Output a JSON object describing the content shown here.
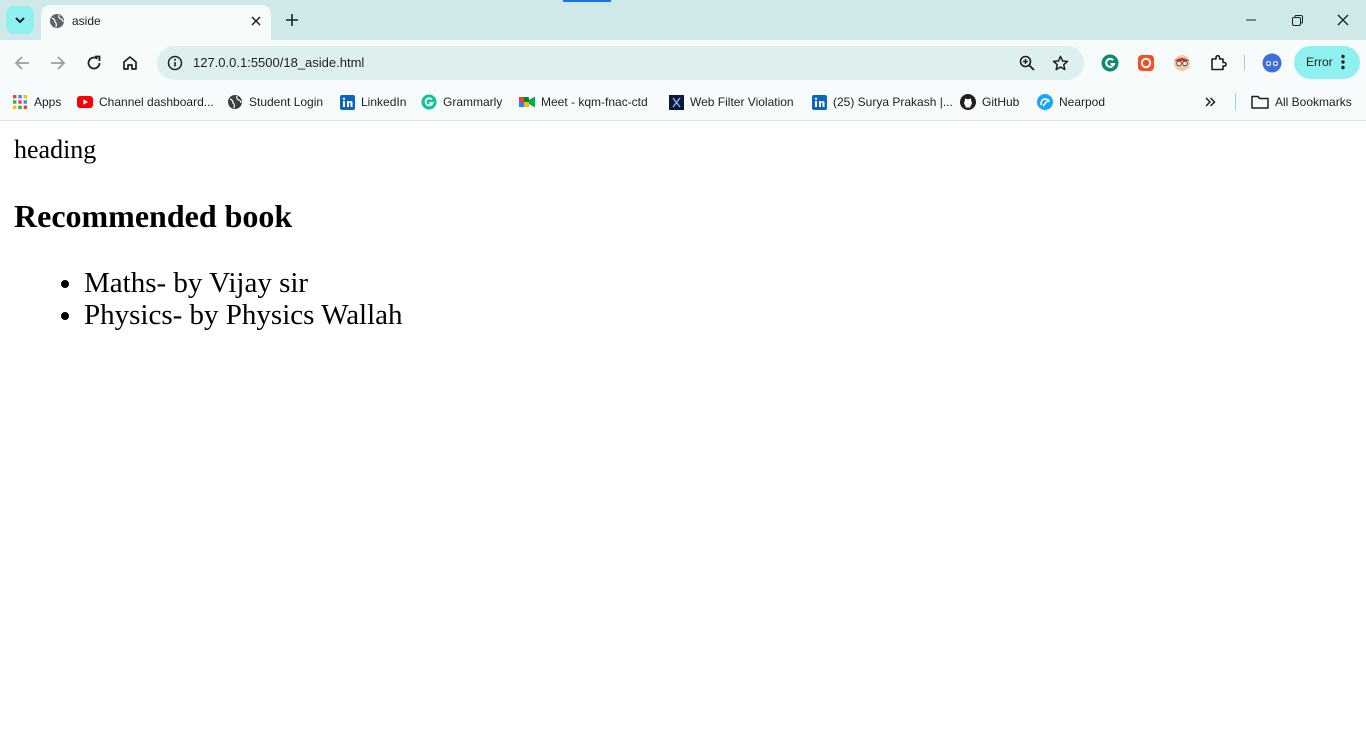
{
  "browser": {
    "tab": {
      "title": "aside",
      "favicon": "globe-icon"
    },
    "omnibox": {
      "url": "127.0.0.1:5500/18_aside.html"
    },
    "profile_button": {
      "label": "Error"
    },
    "colors": {
      "accent": "#1a73e8",
      "tabstrip": "#cfe8e8",
      "toolbar": "#f8fbfb",
      "omnibox": "#ddefef",
      "error_pill": "#8ff0f0"
    }
  },
  "bookmarks": {
    "items": [
      {
        "label": "Apps",
        "icon": "apps-grid-icon"
      },
      {
        "label": "Channel dashboard...",
        "icon": "youtube-icon"
      },
      {
        "label": "Student Login",
        "icon": "globe-icon"
      },
      {
        "label": "LinkedIn",
        "icon": "linkedin-icon"
      },
      {
        "label": "Grammarly",
        "icon": "grammarly-icon"
      },
      {
        "label": "Meet - kqm-fnac-ctd",
        "icon": "meet-icon"
      },
      {
        "label": "Web Filter Violation",
        "icon": "fortinet-icon"
      },
      {
        "label": "(25) Surya Prakash |...",
        "icon": "linkedin-icon"
      },
      {
        "label": "GitHub",
        "icon": "github-icon"
      },
      {
        "label": "Nearpod",
        "icon": "nearpod-icon"
      }
    ],
    "all_bookmarks_label": "All Bookmarks"
  },
  "page": {
    "heading": "heading",
    "section_title": "Recommended book",
    "books": [
      "Maths- by Vijay sir",
      "Physics- by Physics Wallah"
    ]
  }
}
